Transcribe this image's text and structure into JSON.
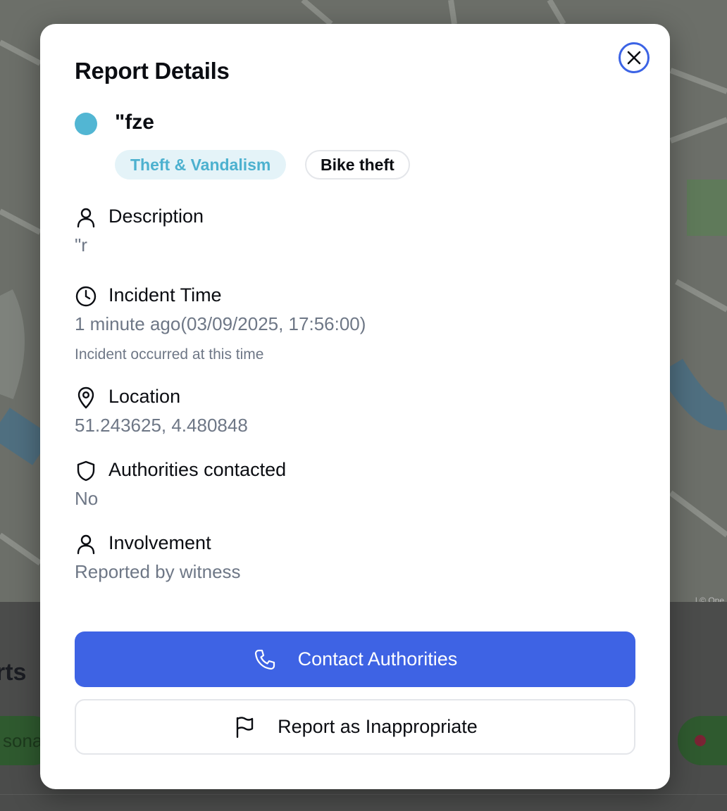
{
  "modal": {
    "title": "Report Details",
    "close_label": "Close",
    "report_name": "\"fze",
    "category_color": "#52b6d3",
    "category_tag": "Theft & Vandalism",
    "subcategory_tag": "Bike theft"
  },
  "sections": {
    "description": {
      "label": "Description",
      "value": "\"r",
      "icon": "user-icon"
    },
    "incident_time": {
      "label": "Incident Time",
      "value": "1 minute ago(03/09/2025, 17:56:00)",
      "note": "Incident occurred at this time",
      "icon": "clock-icon"
    },
    "location": {
      "label": "Location",
      "value": "51.243625, 4.480848",
      "icon": "map-pin-icon"
    },
    "authorities": {
      "label": "Authorities contacted",
      "value": "No",
      "icon": "shield-icon"
    },
    "involvement": {
      "label": "Involvement",
      "value": "Reported by witness",
      "icon": "user-icon"
    }
  },
  "actions": {
    "contact_label": "Contact Authorities",
    "report_label": "Report as Inappropriate"
  },
  "background": {
    "heading_partial": "rts",
    "chip_partial": "sona",
    "attribution_partial": "| © Ope"
  },
  "colors": {
    "primary": "#3e63e4",
    "category": "#52b6d3",
    "muted_text": "#6e7786"
  }
}
